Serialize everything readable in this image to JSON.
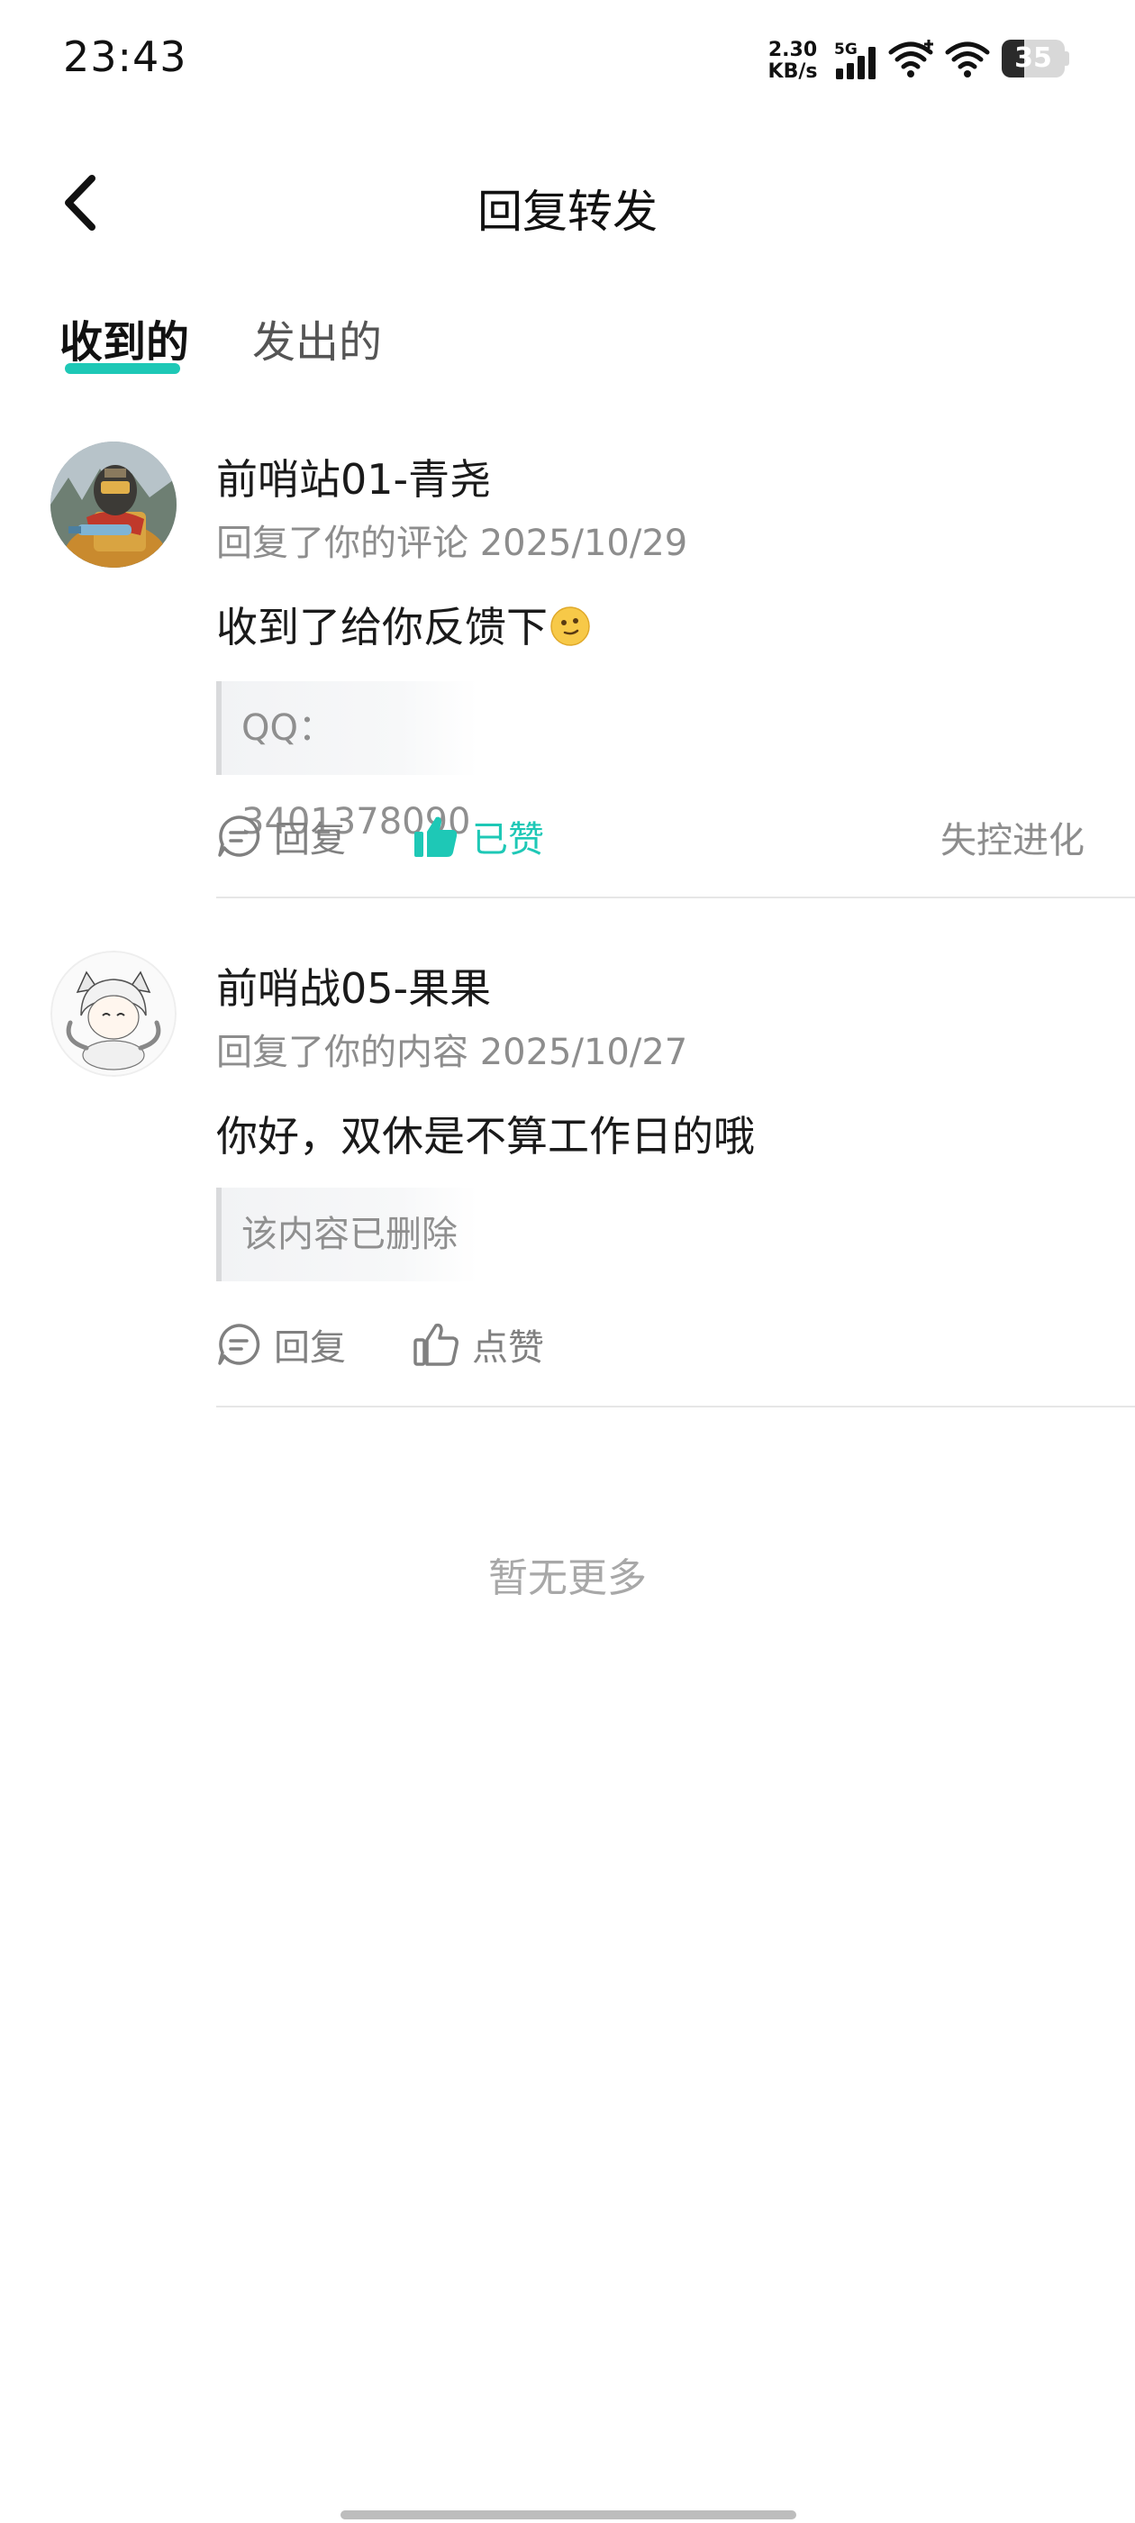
{
  "status_bar": {
    "time": "23:43",
    "net_speed_value": "2.30",
    "net_speed_unit": "KB/s",
    "network_type": "5G",
    "battery_level": "35"
  },
  "header": {
    "title": "回复转发"
  },
  "tabs": [
    {
      "label": "收到的",
      "active": true
    },
    {
      "label": "发出的",
      "active": false
    }
  ],
  "items": [
    {
      "name": "前哨站01-青尧",
      "meta": "回复了你的评论 2025/10/29",
      "content": "收到了给你反馈下",
      "quote": "QQ：3401378090",
      "reply_label": "回复",
      "like_label": "已赞",
      "liked": true,
      "source": "失控进化"
    },
    {
      "name": "前哨战05-果果",
      "meta": "回复了你的内容 2025/10/27",
      "content": "你好，双休是不算工作日的哦",
      "quote": "该内容已删除",
      "reply_label": "回复",
      "like_label": "点赞",
      "liked": false,
      "source": ""
    }
  ],
  "footer": {
    "no_more": "暂无更多"
  },
  "colors": {
    "accent": "#1ec8b6",
    "secondary_text": "#8d8d8d"
  }
}
